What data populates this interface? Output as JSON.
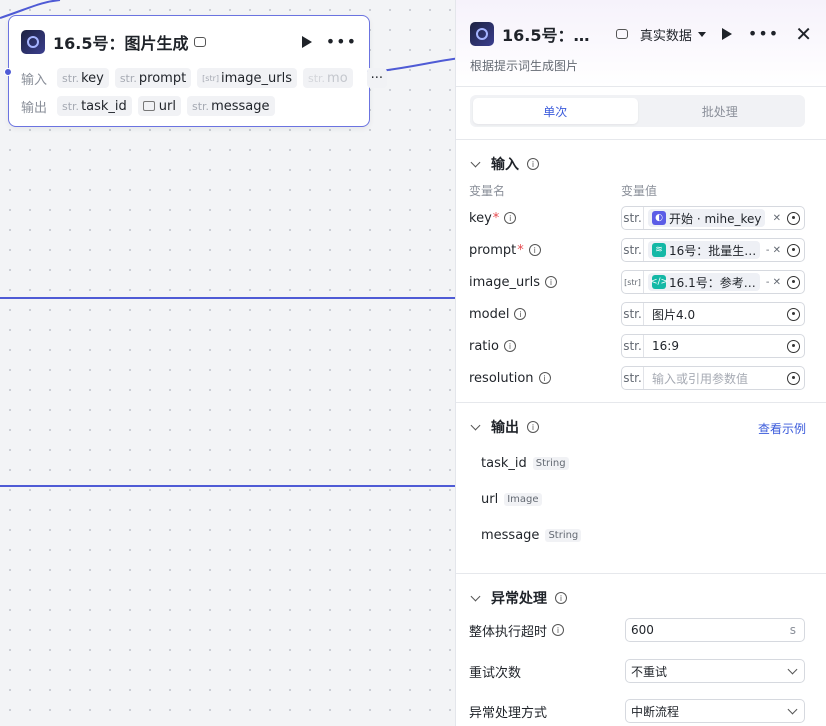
{
  "node": {
    "title": "16.5号：图片生成",
    "input_label": "输入",
    "output_label": "输出",
    "inputs": [
      {
        "type": "str.",
        "name": "key"
      },
      {
        "type": "str.",
        "name": "prompt"
      },
      {
        "type": "[str]",
        "name": "image_urls"
      },
      {
        "type": "str.",
        "name": "mo"
      }
    ],
    "more": "···",
    "outputs": [
      {
        "type": "str.",
        "name": "task_id"
      },
      {
        "type": "",
        "name": "url"
      },
      {
        "type": "str.",
        "name": "message"
      }
    ]
  },
  "panel": {
    "title": "16.5号：…",
    "data_mode": "真实数据",
    "subtitle": "根据提示词生成图片",
    "tabs": [
      "单次",
      "批处理"
    ],
    "input_section": "输入",
    "col_name": "变量名",
    "col_value": "变量值",
    "fields": [
      {
        "name": "key",
        "required": true,
        "type": "str.",
        "ref_text": "开始 · mihe_key",
        "ref_color": "#5b5ce6"
      },
      {
        "name": "prompt",
        "required": true,
        "type": "str.",
        "ref_text": "16号：批量生…",
        "ref_color": "#14b8a6"
      },
      {
        "name": "image_urls",
        "required": false,
        "type": "[str]",
        "ref_text": "16.1号：参考…",
        "ref_color": "#14b8a6"
      },
      {
        "name": "model",
        "required": false,
        "type": "str.",
        "value": "图片4.0"
      },
      {
        "name": "ratio",
        "required": false,
        "type": "str.",
        "value": "16:9"
      },
      {
        "name": "resolution",
        "required": false,
        "type": "str.",
        "placeholder": "输入或引用参数值"
      }
    ],
    "output_section": "输出",
    "example_link": "查看示例",
    "outputs": [
      {
        "name": "task_id",
        "type": "String"
      },
      {
        "name": "url",
        "type": "Image"
      },
      {
        "name": "message",
        "type": "String"
      }
    ],
    "error_section": "异常处理",
    "timeout_label": "整体执行超时",
    "timeout_value": "600",
    "timeout_unit": "s",
    "retry_label": "重试次数",
    "retry_value": "不重试",
    "handling_label": "异常处理方式",
    "handling_value": "中断流程"
  },
  "colors": {
    "accent": "#4f5bd5",
    "link": "#3b5bdb",
    "required": "#e5484d"
  }
}
